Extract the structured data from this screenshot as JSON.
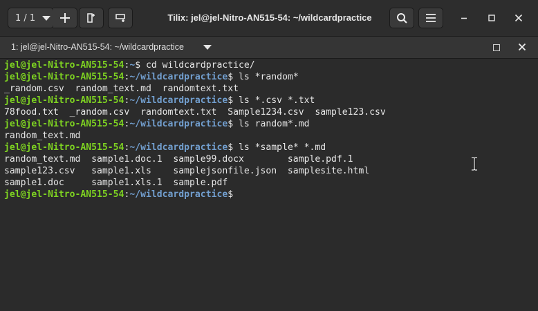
{
  "header": {
    "session_label": "1 / 1",
    "title": "Tilix: jel@jel-Nitro-AN515-54: ~/wildcardpractice"
  },
  "tab": {
    "title": "1: jel@jel-Nitro-AN515-54: ~/wildcardpractice"
  },
  "terminal": {
    "prompt_user": "jel@jel-Nitro-AN515-54",
    "prompt_sep": ":",
    "lines": [
      {
        "path": "~",
        "cmd": "$ cd wildcardpractice/"
      },
      {
        "path": "~/wildcardpractice",
        "cmd": "$ ls *random*"
      },
      {
        "text": "_random.csv  random_text.md  randomtext.txt"
      },
      {
        "path": "~/wildcardpractice",
        "cmd": "$ ls *.csv *.txt"
      },
      {
        "text": "78food.txt  _random.csv  randomtext.txt  Sample1234.csv  sample123.csv"
      },
      {
        "path": "~/wildcardpractice",
        "cmd": "$ ls random*.md"
      },
      {
        "text": "random_text.md"
      },
      {
        "path": "~/wildcardpractice",
        "cmd": "$ ls *sample* *.md"
      },
      {
        "text": "random_text.md  sample1.doc.1  sample99.docx        sample.pdf.1"
      },
      {
        "text": "sample123.csv   sample1.xls    samplejsonfile.json  samplesite.html"
      },
      {
        "text": "sample1.doc     sample1.xls.1  sample.pdf"
      },
      {
        "path": "~/wildcardpractice",
        "cmd": "$"
      }
    ]
  },
  "colors": {
    "user": "#7ed321",
    "path": "#729fcf",
    "text": "#e6e6e6",
    "background": "#2b2b2b"
  },
  "icons": [
    "add-terminal-icon",
    "split-right-icon",
    "split-down-icon",
    "search-icon",
    "menu-icon",
    "minimize-icon",
    "maximize-icon",
    "close-icon",
    "text-cursor-icon"
  ]
}
